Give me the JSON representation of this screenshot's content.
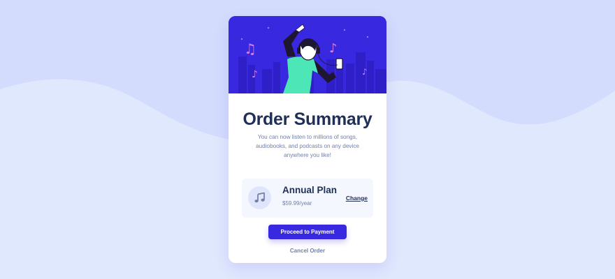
{
  "colors": {
    "background": "#e0e8fd",
    "wave": "#d4dcfd",
    "primary": "#3829e0",
    "heading": "#1f2f56",
    "muted": "#717fa6",
    "plan_bg": "#f5f7ff",
    "accent_teal": "#4ce6b7",
    "accent_pink": "#d37ef0"
  },
  "card": {
    "hero_illustration": "person-dancing-with-headphones",
    "title": "Order Summary",
    "description": "You can now listen to millions of songs, audiobooks, and podcasts on any device anywhere you like!"
  },
  "plan": {
    "icon": "music-note-icon",
    "name": "Annual Plan",
    "price": "$59.99/year",
    "change_label": "Change"
  },
  "actions": {
    "proceed_label": "Proceed to Payment",
    "cancel_label": "Cancel Order"
  }
}
